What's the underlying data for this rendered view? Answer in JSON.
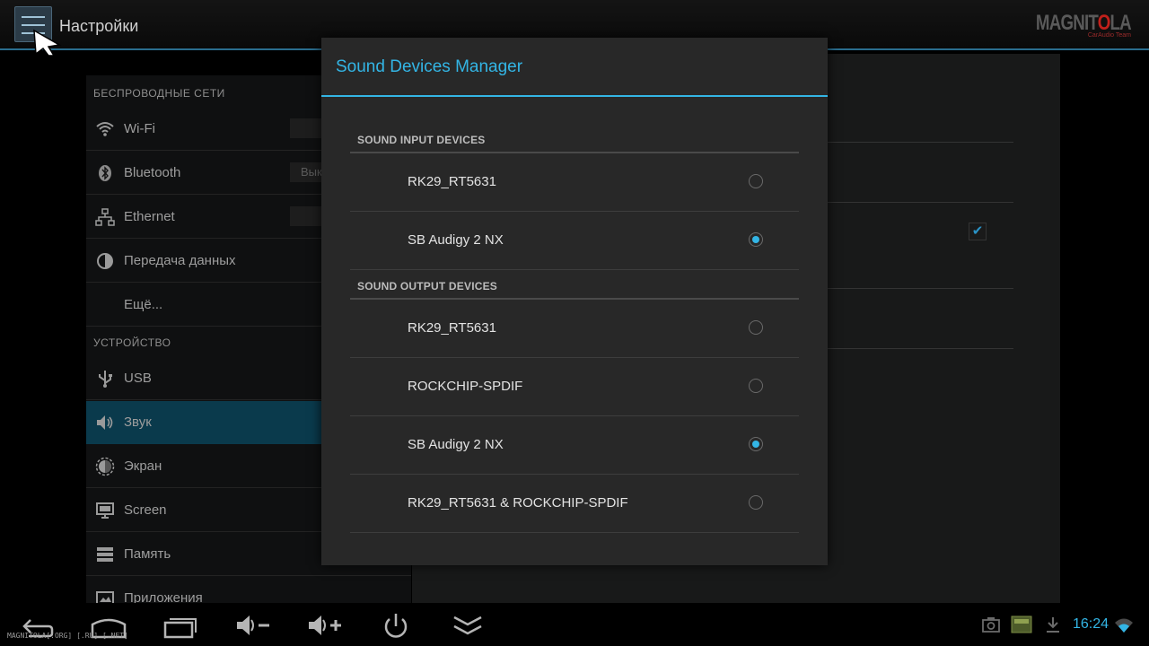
{
  "action_bar": {
    "title": "Настройки",
    "logo_main_left": "MAGNIT",
    "logo_main_o": "O",
    "logo_main_right": "LA",
    "logo_sub": "CarAudio Team"
  },
  "settings": {
    "section_wireless": "БЕСПРОВОДНЫЕ СЕТИ",
    "section_device": "УСТРОЙСТВО",
    "items": [
      {
        "label": "Wi-Fi",
        "icon": "wifi-icon"
      },
      {
        "label": "Bluetooth",
        "icon": "bluetooth-icon",
        "toggle": "Вык"
      },
      {
        "label": "Ethernet",
        "icon": "ethernet-icon"
      },
      {
        "label": "Передача данных",
        "icon": "data-usage-icon"
      },
      {
        "label": "Ещё...",
        "icon": ""
      },
      {
        "label": "USB",
        "icon": "usb-icon"
      },
      {
        "label": "Звук",
        "icon": "sound-icon",
        "selected": true
      },
      {
        "label": "Экран",
        "icon": "display-icon"
      },
      {
        "label": "Screen",
        "icon": "screen-icon"
      },
      {
        "label": "Память",
        "icon": "storage-icon"
      },
      {
        "label": "Приложения",
        "icon": "apps-icon"
      }
    ]
  },
  "dialog": {
    "title": "Sound Devices Manager",
    "input_header": "SOUND INPUT DEVICES",
    "output_header": "SOUND OUTPUT DEVICES",
    "input_devices": [
      {
        "name": "RK29_RT5631",
        "selected": false
      },
      {
        "name": "SB Audigy 2 NX",
        "selected": true
      }
    ],
    "output_devices": [
      {
        "name": "RK29_RT5631",
        "selected": false
      },
      {
        "name": "ROCKCHIP-SPDIF",
        "selected": false
      },
      {
        "name": "SB Audigy 2 NX",
        "selected": true
      },
      {
        "name": "RK29_RT5631 & ROCKCHIP-SPDIF",
        "selected": false
      }
    ]
  },
  "system_bar": {
    "watermark": "MAGNITOLA[.ORG] [.RU] [.NET]",
    "clock": "16:24",
    "accent": "#33b5e5"
  }
}
